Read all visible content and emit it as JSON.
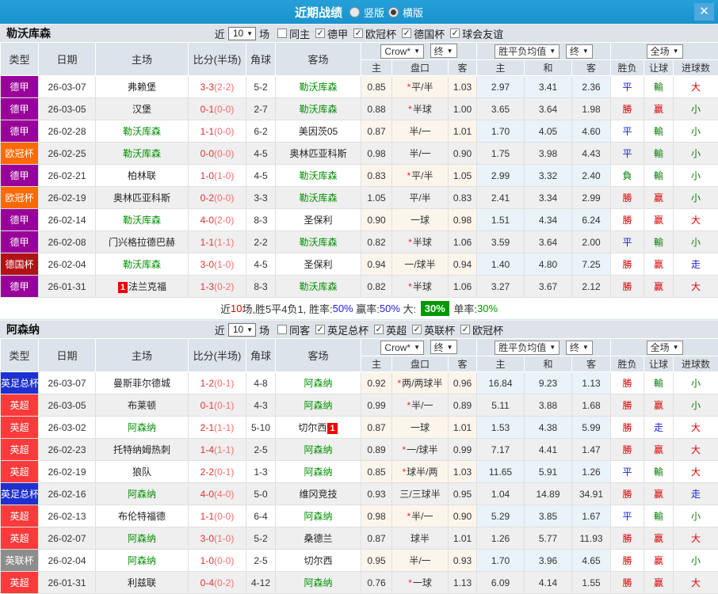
{
  "titlebar": {
    "title": "近期战绩",
    "radio_vertical": "竖版",
    "radio_horizontal": "横版"
  },
  "icons": {
    "close": "✕",
    "dropdown_arrow": "▼",
    "checkmark": "✓"
  },
  "filters_common": {
    "near_label": "近",
    "near_value": "10",
    "games_label": "场"
  },
  "table_header": {
    "type": "类型",
    "date": "日期",
    "home": "主场",
    "score": "比分(半场)",
    "corner": "角球",
    "away": "客场",
    "odds_source": "Crow*",
    "final": "终",
    "avg": "胜平负均值",
    "fullmatch": "全场",
    "sub_home": "主",
    "sub_handicap": "盘口",
    "sub_away": "客",
    "sub_avg_home": "主",
    "sub_draw": "和",
    "sub_avg_away": "客",
    "sub_result": "胜负",
    "sub_spread": "让球",
    "sub_goals": "进球数"
  },
  "league_colors": {
    "德甲": "#990099",
    "欧冠杯": "#ff6a00",
    "德国杯": "#b01218",
    "英足总杯": "#1e30d0",
    "英超": "#fb3b3b",
    "英联杯": "#8d8d8d"
  },
  "result_colors": {
    "勝": "#d40000",
    "平": "#2020cc",
    "負": "#0b7d0b",
    "赢": "#d40000",
    "輸": "#0b7d0b",
    "走": "#2020cc",
    "大": "#e20000",
    "小": "#0b7d0b"
  },
  "sections": [
    {
      "team": "勒沃库森",
      "same_label": "同主",
      "leagues": [
        "德甲",
        "欧冠杯",
        "德国杯",
        "球会友谊"
      ],
      "rows": [
        {
          "type": "德甲",
          "date": "26-03-07",
          "home": "弗赖堡",
          "home_focus": false,
          "home_badge": "",
          "score_ft": "3-3",
          "score_ht": "(2-2)",
          "corner": "5-2",
          "away": "勒沃库森",
          "away_focus": true,
          "away_badge": "",
          "o_home": "0.85",
          "star": true,
          "handicap": "平/半",
          "o_away": "1.03",
          "avg_home": "2.97",
          "avg_draw": "3.41",
          "avg_away": "2.36",
          "result": "平",
          "spread": "輸",
          "goals": "大"
        },
        {
          "type": "德甲",
          "date": "26-03-05",
          "home": "汉堡",
          "home_focus": false,
          "home_badge": "",
          "score_ft": "0-1",
          "score_ht": "(0-0)",
          "corner": "2-7",
          "away": "勒沃库森",
          "away_focus": true,
          "away_badge": "",
          "o_home": "0.88",
          "star": true,
          "handicap": "半球",
          "o_away": "1.00",
          "avg_home": "3.65",
          "avg_draw": "3.64",
          "avg_away": "1.98",
          "result": "勝",
          "spread": "赢",
          "goals": "小"
        },
        {
          "type": "德甲",
          "date": "26-02-28",
          "home": "勒沃库森",
          "home_focus": true,
          "home_badge": "",
          "score_ft": "1-1",
          "score_ht": "(0-0)",
          "corner": "6-2",
          "away": "美因茨05",
          "away_focus": false,
          "away_badge": "",
          "o_home": "0.87",
          "star": false,
          "handicap": "半/一",
          "o_away": "1.01",
          "avg_home": "1.70",
          "avg_draw": "4.05",
          "avg_away": "4.60",
          "result": "平",
          "spread": "輸",
          "goals": "小"
        },
        {
          "type": "欧冠杯",
          "date": "26-02-25",
          "home": "勒沃库森",
          "home_focus": true,
          "home_badge": "",
          "score_ft": "0-0",
          "score_ht": "(0-0)",
          "corner": "4-5",
          "away": "奥林匹亚科斯",
          "away_focus": false,
          "away_badge": "",
          "o_home": "0.98",
          "star": false,
          "handicap": "半/一",
          "o_away": "0.90",
          "avg_home": "1.75",
          "avg_draw": "3.98",
          "avg_away": "4.43",
          "result": "平",
          "spread": "輸",
          "goals": "小"
        },
        {
          "type": "德甲",
          "date": "26-02-21",
          "home": "柏林联",
          "home_focus": false,
          "home_badge": "",
          "score_ft": "1-0",
          "score_ht": "(1-0)",
          "corner": "4-5",
          "away": "勒沃库森",
          "away_focus": true,
          "away_badge": "",
          "o_home": "0.83",
          "star": true,
          "handicap": "平/半",
          "o_away": "1.05",
          "avg_home": "2.99",
          "avg_draw": "3.32",
          "avg_away": "2.40",
          "result": "負",
          "spread": "輸",
          "goals": "小"
        },
        {
          "type": "欧冠杯",
          "date": "26-02-19",
          "home": "奥林匹亚科斯",
          "home_focus": false,
          "home_badge": "",
          "score_ft": "0-2",
          "score_ht": "(0-0)",
          "corner": "3-3",
          "away": "勒沃库森",
          "away_focus": true,
          "away_badge": "",
          "o_home": "1.05",
          "star": false,
          "handicap": "平/半",
          "o_away": "0.83",
          "avg_home": "2.41",
          "avg_draw": "3.34",
          "avg_away": "2.99",
          "result": "勝",
          "spread": "赢",
          "goals": "小"
        },
        {
          "type": "德甲",
          "date": "26-02-14",
          "home": "勒沃库森",
          "home_focus": true,
          "home_badge": "",
          "score_ft": "4-0",
          "score_ht": "(2-0)",
          "corner": "8-3",
          "away": "圣保利",
          "away_focus": false,
          "away_badge": "",
          "o_home": "0.90",
          "star": false,
          "handicap": "一球",
          "o_away": "0.98",
          "avg_home": "1.51",
          "avg_draw": "4.34",
          "avg_away": "6.24",
          "result": "勝",
          "spread": "赢",
          "goals": "大"
        },
        {
          "type": "德甲",
          "date": "26-02-08",
          "home": "门兴格拉德巴赫",
          "home_focus": false,
          "home_badge": "",
          "score_ft": "1-1",
          "score_ht": "(1-1)",
          "corner": "2-2",
          "away": "勒沃库森",
          "away_focus": true,
          "away_badge": "",
          "o_home": "0.82",
          "star": true,
          "handicap": "半球",
          "o_away": "1.06",
          "avg_home": "3.59",
          "avg_draw": "3.64",
          "avg_away": "2.00",
          "result": "平",
          "spread": "輸",
          "goals": "小"
        },
        {
          "type": "德国杯",
          "date": "26-02-04",
          "home": "勒沃库森",
          "home_focus": true,
          "home_badge": "",
          "score_ft": "3-0",
          "score_ht": "(1-0)",
          "corner": "4-5",
          "away": "圣保利",
          "away_focus": false,
          "away_badge": "",
          "o_home": "0.94",
          "star": false,
          "handicap": "一/球半",
          "o_away": "0.94",
          "avg_home": "1.40",
          "avg_draw": "4.80",
          "avg_away": "7.25",
          "result": "勝",
          "spread": "赢",
          "goals": "走"
        },
        {
          "type": "德甲",
          "date": "26-01-31",
          "home": "法兰克福",
          "home_focus": false,
          "home_badge": "1",
          "score_ft": "1-3",
          "score_ht": "(0-2)",
          "corner": "8-3",
          "away": "勒沃库森",
          "away_focus": true,
          "away_badge": "",
          "o_home": "0.82",
          "star": true,
          "handicap": "半球",
          "o_away": "1.06",
          "avg_home": "3.27",
          "avg_draw": "3.67",
          "avg_away": "2.12",
          "result": "勝",
          "spread": "赢",
          "goals": "大"
        }
      ],
      "summary": [
        {
          "text": "近",
          "color": "#333333"
        },
        {
          "text": "10",
          "color": "#e20000"
        },
        {
          "text": "场,胜5平4负1, ",
          "color": "#333333"
        },
        {
          "text": "胜率:",
          "color": "#333333"
        },
        {
          "text": "50%",
          "color": "#2222dd"
        },
        {
          "text": " 赢率:",
          "color": "#333333"
        },
        {
          "text": "50%",
          "color": "#2222dd"
        },
        {
          "text": " 大: ",
          "color": "#333333"
        },
        {
          "text": "30%",
          "color": "#ffffff",
          "bg": "#009900"
        },
        {
          "text": " 单率:",
          "color": "#333333"
        },
        {
          "text": "30%",
          "color": "#009900"
        }
      ]
    },
    {
      "team": "阿森纳",
      "same_label": "同客",
      "leagues": [
        "英足总杯",
        "英超",
        "英联杯",
        "欧冠杯"
      ],
      "rows": [
        {
          "type": "英足总杯",
          "date": "26-03-07",
          "home": "曼斯菲尔德城",
          "home_focus": false,
          "home_badge": "",
          "score_ft": "1-2",
          "score_ht": "(0-1)",
          "corner": "4-8",
          "away": "阿森纳",
          "away_focus": true,
          "away_badge": "",
          "o_home": "0.92",
          "star": true,
          "handicap": "两/两球半",
          "o_away": "0.96",
          "avg_home": "16.84",
          "avg_draw": "9.23",
          "avg_away": "1.13",
          "result": "勝",
          "spread": "輸",
          "goals": "小"
        },
        {
          "type": "英超",
          "date": "26-03-05",
          "home": "布莱顿",
          "home_focus": false,
          "home_badge": "",
          "score_ft": "0-1",
          "score_ht": "(0-1)",
          "corner": "4-3",
          "away": "阿森纳",
          "away_focus": true,
          "away_badge": "",
          "o_home": "0.99",
          "star": true,
          "handicap": "半/一",
          "o_away": "0.89",
          "avg_home": "5.11",
          "avg_draw": "3.88",
          "avg_away": "1.68",
          "result": "勝",
          "spread": "赢",
          "goals": "小"
        },
        {
          "type": "英超",
          "date": "26-03-02",
          "home": "阿森纳",
          "home_focus": true,
          "home_badge": "",
          "score_ft": "2-1",
          "score_ht": "(1-1)",
          "corner": "5-10",
          "away": "切尔西",
          "away_focus": false,
          "away_badge": "1",
          "o_home": "0.87",
          "star": false,
          "handicap": "一球",
          "o_away": "1.01",
          "avg_home": "1.53",
          "avg_draw": "4.38",
          "avg_away": "5.99",
          "result": "勝",
          "spread": "走",
          "goals": "大"
        },
        {
          "type": "英超",
          "date": "26-02-23",
          "home": "托特纳姆热刺",
          "home_focus": false,
          "home_badge": "",
          "score_ft": "1-4",
          "score_ht": "(1-1)",
          "corner": "2-5",
          "away": "阿森纳",
          "away_focus": true,
          "away_badge": "",
          "o_home": "0.89",
          "star": true,
          "handicap": "一/球半",
          "o_away": "0.99",
          "avg_home": "7.17",
          "avg_draw": "4.41",
          "avg_away": "1.47",
          "result": "勝",
          "spread": "赢",
          "goals": "大"
        },
        {
          "type": "英超",
          "date": "26-02-19",
          "home": "狼队",
          "home_focus": false,
          "home_badge": "",
          "score_ft": "2-2",
          "score_ht": "(0-1)",
          "corner": "1-3",
          "away": "阿森纳",
          "away_focus": true,
          "away_badge": "",
          "o_home": "0.85",
          "star": true,
          "handicap": "球半/两",
          "o_away": "1.03",
          "avg_home": "11.65",
          "avg_draw": "5.91",
          "avg_away": "1.26",
          "result": "平",
          "spread": "輸",
          "goals": "大"
        },
        {
          "type": "英足总杯",
          "date": "26-02-16",
          "home": "阿森纳",
          "home_focus": true,
          "home_badge": "",
          "score_ft": "4-0",
          "score_ht": "(4-0)",
          "corner": "5-0",
          "away": "维冈竞技",
          "away_focus": false,
          "away_badge": "",
          "o_home": "0.93",
          "star": false,
          "handicap": "三/三球半",
          "o_away": "0.95",
          "avg_home": "1.04",
          "avg_draw": "14.89",
          "avg_away": "34.91",
          "result": "勝",
          "spread": "赢",
          "goals": "走"
        },
        {
          "type": "英超",
          "date": "26-02-13",
          "home": "布伦特福德",
          "home_focus": false,
          "home_badge": "",
          "score_ft": "1-1",
          "score_ht": "(0-0)",
          "corner": "6-4",
          "away": "阿森纳",
          "away_focus": true,
          "away_badge": "",
          "o_home": "0.98",
          "star": true,
          "handicap": "半/一",
          "o_away": "0.90",
          "avg_home": "5.29",
          "avg_draw": "3.85",
          "avg_away": "1.67",
          "result": "平",
          "spread": "輸",
          "goals": "小"
        },
        {
          "type": "英超",
          "date": "26-02-07",
          "home": "阿森纳",
          "home_focus": true,
          "home_badge": "",
          "score_ft": "3-0",
          "score_ht": "(1-0)",
          "corner": "5-2",
          "away": "桑德兰",
          "away_focus": false,
          "away_badge": "",
          "o_home": "0.87",
          "star": false,
          "handicap": "球半",
          "o_away": "1.01",
          "avg_home": "1.26",
          "avg_draw": "5.77",
          "avg_away": "11.93",
          "result": "勝",
          "spread": "赢",
          "goals": "大"
        },
        {
          "type": "英联杯",
          "date": "26-02-04",
          "home": "阿森纳",
          "home_focus": true,
          "home_badge": "",
          "score_ft": "1-0",
          "score_ht": "(0-0)",
          "corner": "2-5",
          "away": "切尔西",
          "away_focus": false,
          "away_badge": "",
          "o_home": "0.95",
          "star": false,
          "handicap": "半/一",
          "o_away": "0.93",
          "avg_home": "1.70",
          "avg_draw": "3.96",
          "avg_away": "4.65",
          "result": "勝",
          "spread": "赢",
          "goals": "小"
        },
        {
          "type": "英超",
          "date": "26-01-31",
          "home": "利兹联",
          "home_focus": false,
          "home_badge": "",
          "score_ft": "0-4",
          "score_ht": "(0-2)",
          "corner": "4-12",
          "away": "阿森纳",
          "away_focus": true,
          "away_badge": "",
          "o_home": "0.76",
          "star": true,
          "handicap": "一球",
          "o_away": "1.13",
          "avg_home": "6.09",
          "avg_draw": "4.14",
          "avg_away": "1.55",
          "result": "勝",
          "spread": "赢",
          "goals": "大"
        }
      ],
      "summary": null
    }
  ]
}
